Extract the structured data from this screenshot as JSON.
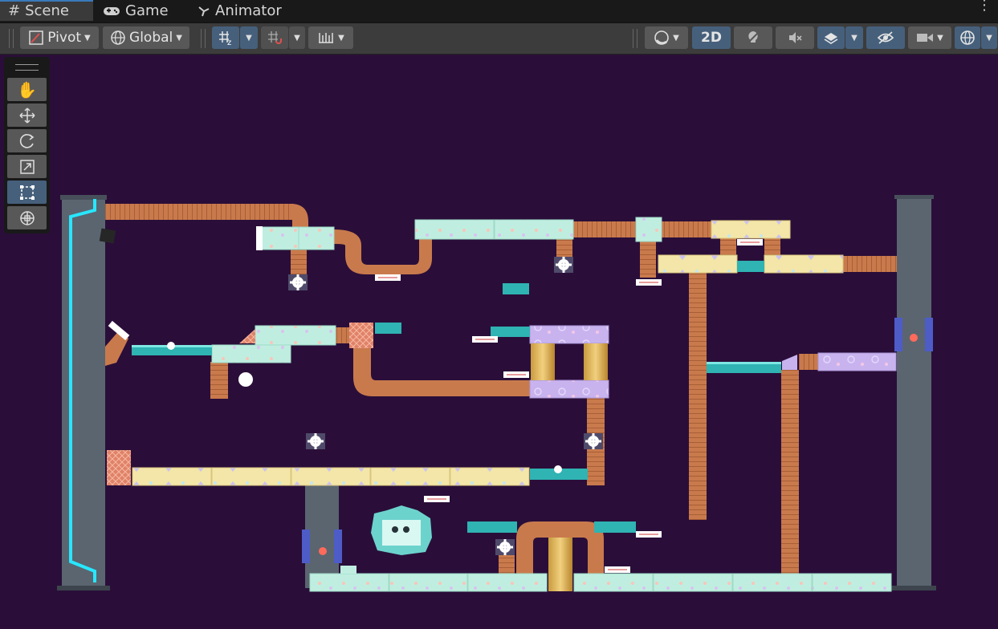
{
  "tabs": [
    {
      "label": "Scene",
      "icon": "#"
    },
    {
      "label": "Game",
      "icon": "gamepad-icon"
    },
    {
      "label": "Animator",
      "icon": "animator-icon"
    }
  ],
  "toolbar": {
    "pivot_label": "Pivot",
    "global_label": "Global",
    "mode_2d_label": "2D"
  },
  "tools": [
    "hand-tool",
    "move-tool",
    "rotate-tool",
    "scale-tool",
    "rect-tool",
    "transform-tool"
  ],
  "selected_tool": "rect-tool",
  "colors": {
    "scene_bg": "#2a0e39",
    "pipe": "#c97a4c",
    "pillar": "#5a6570",
    "neon": "#27e7ff",
    "mint_block": "#bfeee0",
    "yellow_block": "#f3e6a8",
    "lilac_block": "#c8b3ef",
    "teal_platform": "#2fb3b3"
  }
}
